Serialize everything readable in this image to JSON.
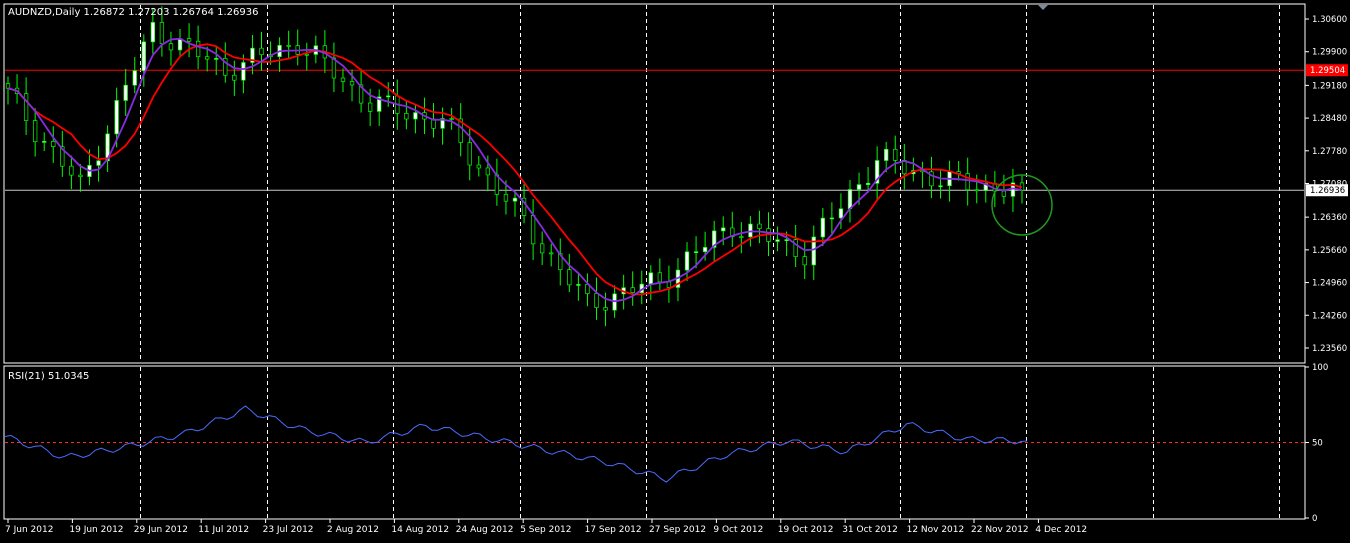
{
  "chart_data": {
    "type": "candlestick",
    "price_panel": {
      "header": "AUDNZD,Daily  1.26872 1.27203 1.26764 1.26936",
      "y_ticks": [
        "1.30600",
        "1.29900",
        "1.29180",
        "1.28480",
        "1.27780",
        "1.27080",
        "1.26360",
        "1.25660",
        "1.24960",
        "1.24260",
        "1.23560"
      ],
      "ylim": [
        1.2326,
        1.309
      ],
      "current_price_label": "1.26936",
      "current_price": 1.26936,
      "resistance_label": "1.29504",
      "resistance": 1.29504,
      "series": [
        {
          "name": "MA fast",
          "color": "#8a2be2"
        },
        {
          "name": "MA slow",
          "color": "#ff0000"
        }
      ],
      "annotation": "circle around latest candles",
      "key_points": [
        {
          "date": "7 Jun 2012",
          "close": 1.29
        },
        {
          "date": "25 Jun 2012",
          "close": 1.27
        },
        {
          "date": "23 Jul 2012",
          "close": 1.304
        },
        {
          "date": "31 Jul 2012",
          "close": 1.295
        },
        {
          "date": "14 Aug 2012",
          "close": 1.301
        },
        {
          "date": "24 Aug 2012",
          "close": 1.288
        },
        {
          "date": "5 Sep 2012",
          "close": 1.284
        },
        {
          "date": "17 Sep 2012",
          "close": 1.265
        },
        {
          "date": "27 Sep 2012",
          "close": 1.245
        },
        {
          "date": "9 Oct 2012",
          "close": 1.25
        },
        {
          "date": "19 Oct 2012",
          "close": 1.262
        },
        {
          "date": "31 Oct 2012",
          "close": 1.256
        },
        {
          "date": "12 Nov 2012",
          "close": 1.276
        },
        {
          "date": "22 Nov 2012",
          "close": 1.271
        },
        {
          "date": "4 Dec 2012",
          "close": 1.2694
        }
      ]
    },
    "rsi_panel": {
      "header": "RSI(21) 51.0345",
      "y_ticks": [
        "100",
        "50",
        "0"
      ],
      "ylim": [
        0,
        100
      ],
      "level": 50,
      "key_points": [
        {
          "date": "7 Jun 2012",
          "value": 54
        },
        {
          "date": "19 Jun 2012",
          "value": 40
        },
        {
          "date": "29 Jun 2012",
          "value": 47
        },
        {
          "date": "11 Jul 2012",
          "value": 56
        },
        {
          "date": "23 Jul 2012",
          "value": 72
        },
        {
          "date": "27 Jul 2012",
          "value": 58
        },
        {
          "date": "2 Aug 2012",
          "value": 50
        },
        {
          "date": "14 Aug 2012",
          "value": 61
        },
        {
          "date": "24 Aug 2012",
          "value": 53
        },
        {
          "date": "5 Sep 2012",
          "value": 45
        },
        {
          "date": "17 Sep 2012",
          "value": 37
        },
        {
          "date": "27 Sep 2012",
          "value": 26
        },
        {
          "date": "9 Oct 2012",
          "value": 42
        },
        {
          "date": "19 Oct 2012",
          "value": 51
        },
        {
          "date": "31 Oct 2012",
          "value": 44
        },
        {
          "date": "12 Nov 2012",
          "value": 62
        },
        {
          "date": "22 Nov 2012",
          "value": 52
        },
        {
          "date": "4 Dec 2012",
          "value": 51
        }
      ]
    },
    "x_labels": [
      "7 Jun 2012",
      "19 Jun 2012",
      "29 Jun 2012",
      "11 Jul 2012",
      "23 Jul 2012",
      "2 Aug 2012",
      "14 Aug 2012",
      "24 Aug 2012",
      "5 Sep 2012",
      "17 Sep 2012",
      "27 Sep 2012",
      "9 Oct 2012",
      "19 Oct 2012",
      "31 Oct 2012",
      "12 Nov 2012",
      "22 Nov 2012",
      "4 Dec 2012"
    ],
    "colors": {
      "background": "#000000",
      "up_candle": "#ffffff",
      "down_candle": "#000000",
      "wick": "#00ff00",
      "grid": "#ffffff",
      "resistance": "#ff0000",
      "rsi_line": "#4a6cff",
      "rsi_level": "#ff2a2a",
      "circle": "#1f9a1f",
      "axis_text": "#ffffff"
    }
  }
}
